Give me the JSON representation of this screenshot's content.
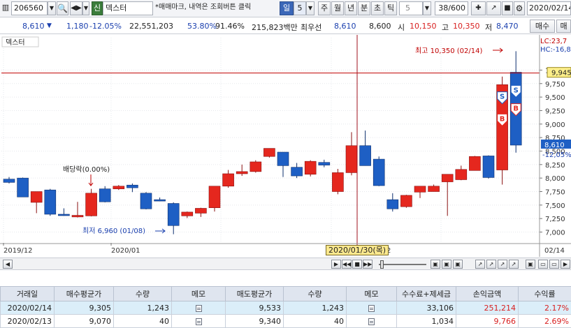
{
  "toolbar": {
    "code": "206560",
    "market_tag": "신",
    "stock_name": "덱스터",
    "notice": "*매매마크, 내역은 조회버튼 클릭",
    "period_sel": "일",
    "period_num": "5",
    "periods": [
      "주",
      "월",
      "년",
      "분",
      "초",
      "틱"
    ],
    "tick_num": "5",
    "page_count": "38/600",
    "date": "2020/02/14"
  },
  "quote": {
    "price": "8,610",
    "change": "1,180",
    "change_pct": "-12.05%",
    "volume": "22,551,203",
    "ratio1": "53.80%",
    "ratio2": "91.46%",
    "amount": "215,823백만",
    "best_label": "최우선",
    "best_ask": "8,610",
    "best_bid": "8,600",
    "open_label": "시",
    "open": "10,150",
    "high_label": "고",
    "high": "10,350",
    "low_label": "저",
    "low": "8,470",
    "buy_btn": "매수",
    "sell_btn": "매"
  },
  "chart": {
    "stock_label": "덱스터",
    "lc_label": "LC:23,7",
    "hc_label": "HC:-16,8",
    "ref_price_label": "9,945",
    "cur_price_label": "8,610",
    "cur_pct_label": "-12,05%",
    "hi_annot": "최고 10,350 (02/14)",
    "lo_annot": "최저 6,960 (01/08)",
    "div_annot": "배당락(0.00%)",
    "x_labels": [
      "2019/12",
      "2020/01",
      "2",
      "02/14"
    ],
    "date_tip": "2020/01/30(목)",
    "colors": {
      "up": "#e5271e",
      "down": "#1e5fc4",
      "ref_line": "#c00000",
      "cursor": "#a0101e"
    }
  },
  "chart_data": {
    "type": "candlestick",
    "ylim": [
      6800,
      10600
    ],
    "y_ticks": [
      7000,
      7250,
      7500,
      7750,
      8000,
      8250,
      8500,
      8750,
      9000,
      9250,
      9500,
      9750,
      10000
    ],
    "candles": [
      {
        "o": 7980,
        "h": 8020,
        "l": 7900,
        "c": 7920
      },
      {
        "o": 8000,
        "h": 8010,
        "l": 7650,
        "c": 7650
      },
      {
        "o": 7550,
        "h": 7740,
        "l": 7350,
        "c": 7750
      },
      {
        "o": 7780,
        "h": 7800,
        "l": 7300,
        "c": 7330
      },
      {
        "o": 7330,
        "h": 7440,
        "l": 7300,
        "c": 7310
      },
      {
        "o": 7280,
        "h": 7560,
        "l": 7270,
        "c": 7310
      },
      {
        "o": 7300,
        "h": 7800,
        "l": 7290,
        "c": 7720
      },
      {
        "o": 7800,
        "h": 7850,
        "l": 7550,
        "c": 7560
      },
      {
        "o": 7800,
        "h": 7870,
        "l": 7780,
        "c": 7850
      },
      {
        "o": 7870,
        "h": 7900,
        "l": 7740,
        "c": 7820
      },
      {
        "o": 7720,
        "h": 7740,
        "l": 7420,
        "c": 7430
      },
      {
        "o": 7600,
        "h": 7640,
        "l": 7570,
        "c": 7590
      },
      {
        "o": 7530,
        "h": 7550,
        "l": 6960,
        "c": 7120
      },
      {
        "o": 7300,
        "h": 7380,
        "l": 7260,
        "c": 7370
      },
      {
        "o": 7350,
        "h": 7450,
        "l": 7280,
        "c": 7440
      },
      {
        "o": 7450,
        "h": 7850,
        "l": 7380,
        "c": 7850
      },
      {
        "o": 7850,
        "h": 8150,
        "l": 7820,
        "c": 8080
      },
      {
        "o": 8080,
        "h": 8250,
        "l": 8040,
        "c": 8120
      },
      {
        "o": 8120,
        "h": 8330,
        "l": 8100,
        "c": 8300
      },
      {
        "o": 8400,
        "h": 8550,
        "l": 8380,
        "c": 8550
      },
      {
        "o": 8480,
        "h": 8480,
        "l": 8020,
        "c": 8230
      },
      {
        "o": 8200,
        "h": 8280,
        "l": 8000,
        "c": 8040
      },
      {
        "o": 8070,
        "h": 8330,
        "l": 8030,
        "c": 8310
      },
      {
        "o": 8290,
        "h": 8340,
        "l": 8200,
        "c": 8240
      },
      {
        "o": 7750,
        "h": 8170,
        "l": 7700,
        "c": 8100
      },
      {
        "o": 8100,
        "h": 8850,
        "l": 8050,
        "c": 8600
      },
      {
        "o": 8600,
        "h": 8880,
        "l": 8230,
        "c": 8230
      },
      {
        "o": 8350,
        "h": 8400,
        "l": 7850,
        "c": 7860
      },
      {
        "o": 7600,
        "h": 7720,
        "l": 7380,
        "c": 7430
      },
      {
        "o": 7470,
        "h": 7690,
        "l": 7450,
        "c": 7680
      },
      {
        "o": 7740,
        "h": 7840,
        "l": 7630,
        "c": 7850
      },
      {
        "o": 7750,
        "h": 7880,
        "l": 7750,
        "c": 7850
      },
      {
        "o": 7930,
        "h": 8050,
        "l": 7300,
        "c": 8070
      },
      {
        "o": 7970,
        "h": 8230,
        "l": 7960,
        "c": 8160
      },
      {
        "o": 8140,
        "h": 8410,
        "l": 8140,
        "c": 8400
      },
      {
        "o": 8410,
        "h": 8420,
        "l": 7990,
        "c": 8010
      },
      {
        "o": 8150,
        "h": 9880,
        "l": 7880,
        "c": 9730
      },
      {
        "o": 9960,
        "h": 10350,
        "l": 8470,
        "c": 8610
      }
    ]
  },
  "scroll": {
    "zoom_icons": [
      "□",
      "□",
      "□",
      "□",
      "□",
      "□"
    ]
  },
  "table": {
    "headers": [
      "거래일",
      "매수평균가",
      "수량",
      "메모",
      "매도평균가",
      "수량",
      "메모",
      "수수료+제세금",
      "손익금액",
      "수익률"
    ],
    "rows": [
      {
        "date": "2020/02/14",
        "buy_avg": "9,305",
        "buy_qty": "1,243",
        "sell_avg": "9,533",
        "sell_qty": "1,243",
        "fee": "33,106",
        "pl": "251,214",
        "ret": "2.17%"
      },
      {
        "date": "2020/02/13",
        "buy_avg": "9,070",
        "buy_qty": "40",
        "sell_avg": "9,340",
        "sell_qty": "40",
        "fee": "1,034",
        "pl": "9,766",
        "ret": "2.69%"
      }
    ]
  }
}
